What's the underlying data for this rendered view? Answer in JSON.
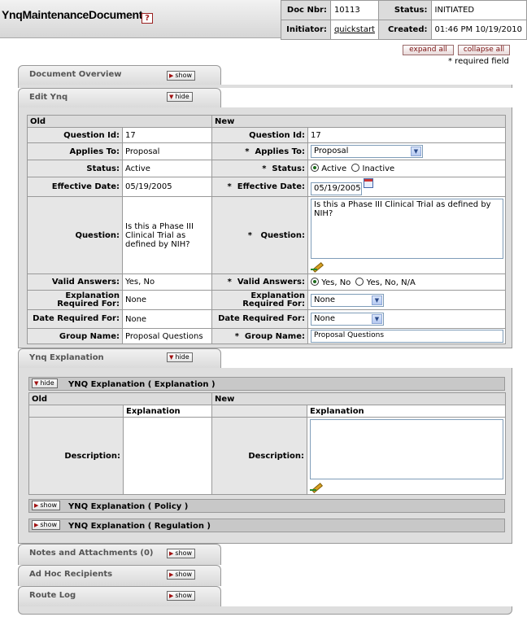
{
  "header": {
    "doc_title": "YnqMaintenanceDocument",
    "help_glyph": "?",
    "doc_nbr_label": "Doc Nbr:",
    "doc_nbr": "10113",
    "status_label": "Status:",
    "status": "INITIATED",
    "initiator_label": "Initiator:",
    "initiator": "quickstart",
    "created_label": "Created:",
    "created": "01:46 PM 10/19/2010"
  },
  "controls": {
    "expand_all": "expand all",
    "collapse_all": "collapse all",
    "required_note": "* required field"
  },
  "tabs": {
    "document_overview": {
      "title": "Document Overview",
      "toggle": "show"
    },
    "edit_ynq": {
      "title": "Edit Ynq",
      "toggle": "hide"
    },
    "ynq_explanation": {
      "title": "Ynq Explanation",
      "toggle": "hide"
    },
    "notes": {
      "title": "Notes and Attachments (0)",
      "toggle": "show"
    },
    "adhoc": {
      "title": "Ad Hoc Recipients",
      "toggle": "show"
    },
    "route_log": {
      "title": "Route Log",
      "toggle": "show"
    }
  },
  "edit": {
    "old_header": "Old",
    "new_header": "New",
    "labels": {
      "question_id": "Question Id:",
      "applies_to": "Applies To:",
      "status": "Status:",
      "effective_date": "Effective Date:",
      "question": "Question:",
      "valid_answers": "Valid Answers:",
      "explanation_required": "Explanation Required For:",
      "date_required": "Date Required For:",
      "group_name": "Group Name:"
    },
    "required_mark": "*",
    "old": {
      "question_id": "17",
      "applies_to": "Proposal",
      "status": "Active",
      "effective_date": "05/19/2005",
      "question": "Is this a Phase III Clinical Trial as defined by NIH?",
      "valid_answers": "Yes, No",
      "explanation_required": "None",
      "date_required": "None",
      "group_name": "Proposal Questions"
    },
    "new": {
      "question_id": "17",
      "applies_to": "Proposal",
      "status_active": "Active",
      "status_inactive": "Inactive",
      "effective_date": "05/19/2005",
      "question": "Is this a Phase III Clinical Trial as defined by NIH?",
      "valid_yes_no": "Yes, No",
      "valid_yes_no_na": "Yes, No, N/A",
      "explanation_required": "None",
      "date_required": "None",
      "group_name": "Proposal Questions"
    }
  },
  "explanation": {
    "sub_explanation": {
      "title": "YNQ Explanation ( Explanation )",
      "toggle": "hide"
    },
    "sub_policy": {
      "title": "YNQ Explanation ( Policy )",
      "toggle": "show"
    },
    "sub_regulation": {
      "title": "YNQ Explanation ( Regulation )",
      "toggle": "show"
    },
    "old_header": "Old",
    "new_header": "New",
    "col_header": "Explanation",
    "description_label": "Description:"
  },
  "colors": {
    "accent_red": "#a01010",
    "radio_selected": "#1a6a1a"
  }
}
